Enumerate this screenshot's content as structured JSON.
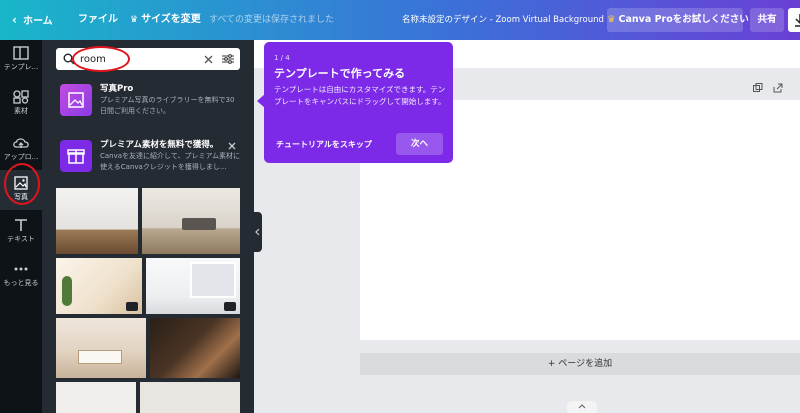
{
  "topbar": {
    "home_label": "ホーム",
    "file_label": "ファイル",
    "resize_label": "サイズを変更",
    "save_status": "すべての変更は保存されました",
    "design_title": "名称未設定のデザイン - Zoom Virtual Background",
    "pro_label": "Canva Proをお試しください",
    "share_label": "共有"
  },
  "rail": {
    "items": [
      {
        "label": "テンプレ..."
      },
      {
        "label": "素材"
      },
      {
        "label": "アップロ..."
      },
      {
        "label": "写真"
      },
      {
        "label": "テキスト"
      },
      {
        "label": "もっと見る"
      }
    ]
  },
  "search": {
    "value": "room"
  },
  "promos": [
    {
      "title": "写真Pro",
      "desc": "プレミアム写真のライブラリーを無料で30日間ご利用ください。",
      "icon": "image-icon"
    },
    {
      "title": "プレミアム素材を無料で獲得。",
      "desc": "Canvaを友達に紹介して、プレミアム素材に使えるCanvaクレジットを獲得しまし...",
      "icon": "gift-icon"
    }
  ],
  "tooltip": {
    "step": "1 / 4",
    "title": "テンプレートで作ってみる",
    "body": "テンプレートは自由にカスタマイズできます。テンプレートをキャンバスにドラッグして開始します。",
    "skip_label": "チュートリアルをスキップ",
    "next_label": "次へ"
  },
  "canvas": {
    "add_page_label": "+ ページを追加"
  },
  "colors": {
    "accent": "#7c2ae8",
    "annotation": "#e0141c"
  }
}
